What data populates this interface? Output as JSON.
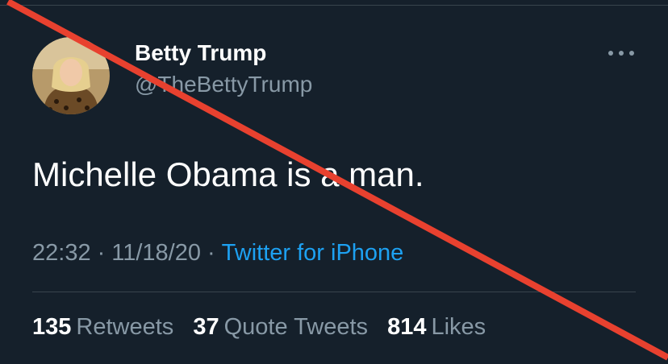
{
  "tweet": {
    "author": {
      "display_name": "Betty Trump",
      "handle": "@TheBettyTrump"
    },
    "text": "Michelle Obama is a man.",
    "time": "22:32",
    "date": "11/18/20",
    "separator": "·",
    "source": "Twitter for iPhone",
    "more_icon": "more-horizontal-icon"
  },
  "stats": {
    "retweets": {
      "count": "135",
      "label": "Retweets"
    },
    "quote_tweets": {
      "count": "37",
      "label": "Quote Tweets"
    },
    "likes": {
      "count": "814",
      "label": "Likes"
    }
  },
  "overlay": {
    "strike_color": "#e8412f"
  },
  "colors": {
    "background": "#15202b",
    "secondary_text": "#8899a6",
    "link": "#1da1f2",
    "divider": "#38444d"
  }
}
